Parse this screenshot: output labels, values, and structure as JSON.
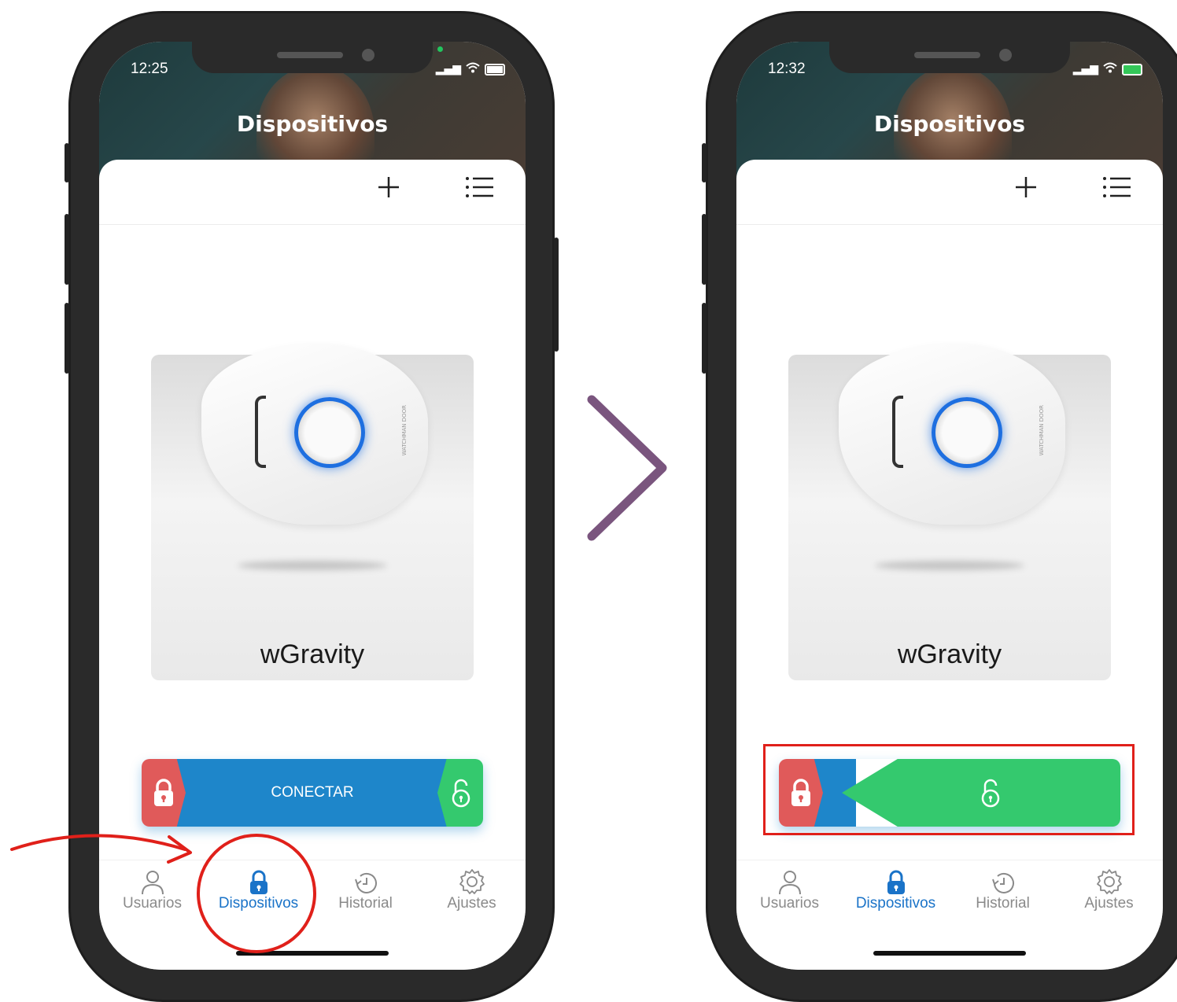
{
  "screens": [
    {
      "status_time": "12:25",
      "title": "Dispositivos",
      "device_name": "wGravity",
      "device_brand": "WATCHMAN DOOR",
      "action_label": "CONECTAR",
      "action_state": "disconnected"
    },
    {
      "status_time": "12:32",
      "title": "Dispositivos",
      "device_name": "wGravity",
      "device_brand": "WATCHMAN DOOR",
      "action_label": "",
      "action_state": "connected"
    }
  ],
  "tabs": [
    {
      "label": "Usuarios",
      "icon": "user-icon",
      "active": false
    },
    {
      "label": "Dispositivos",
      "icon": "lock-icon",
      "active": true
    },
    {
      "label": "Historial",
      "icon": "history-icon",
      "active": false
    },
    {
      "label": "Ajustes",
      "icon": "gear-icon",
      "active": false
    }
  ],
  "colors": {
    "accent_blue": "#1e86ca",
    "lock_red": "#e05a5a",
    "unlock_green": "#34c96e",
    "annotation_red": "#e0201a",
    "chevron_purple": "#7a557e"
  }
}
